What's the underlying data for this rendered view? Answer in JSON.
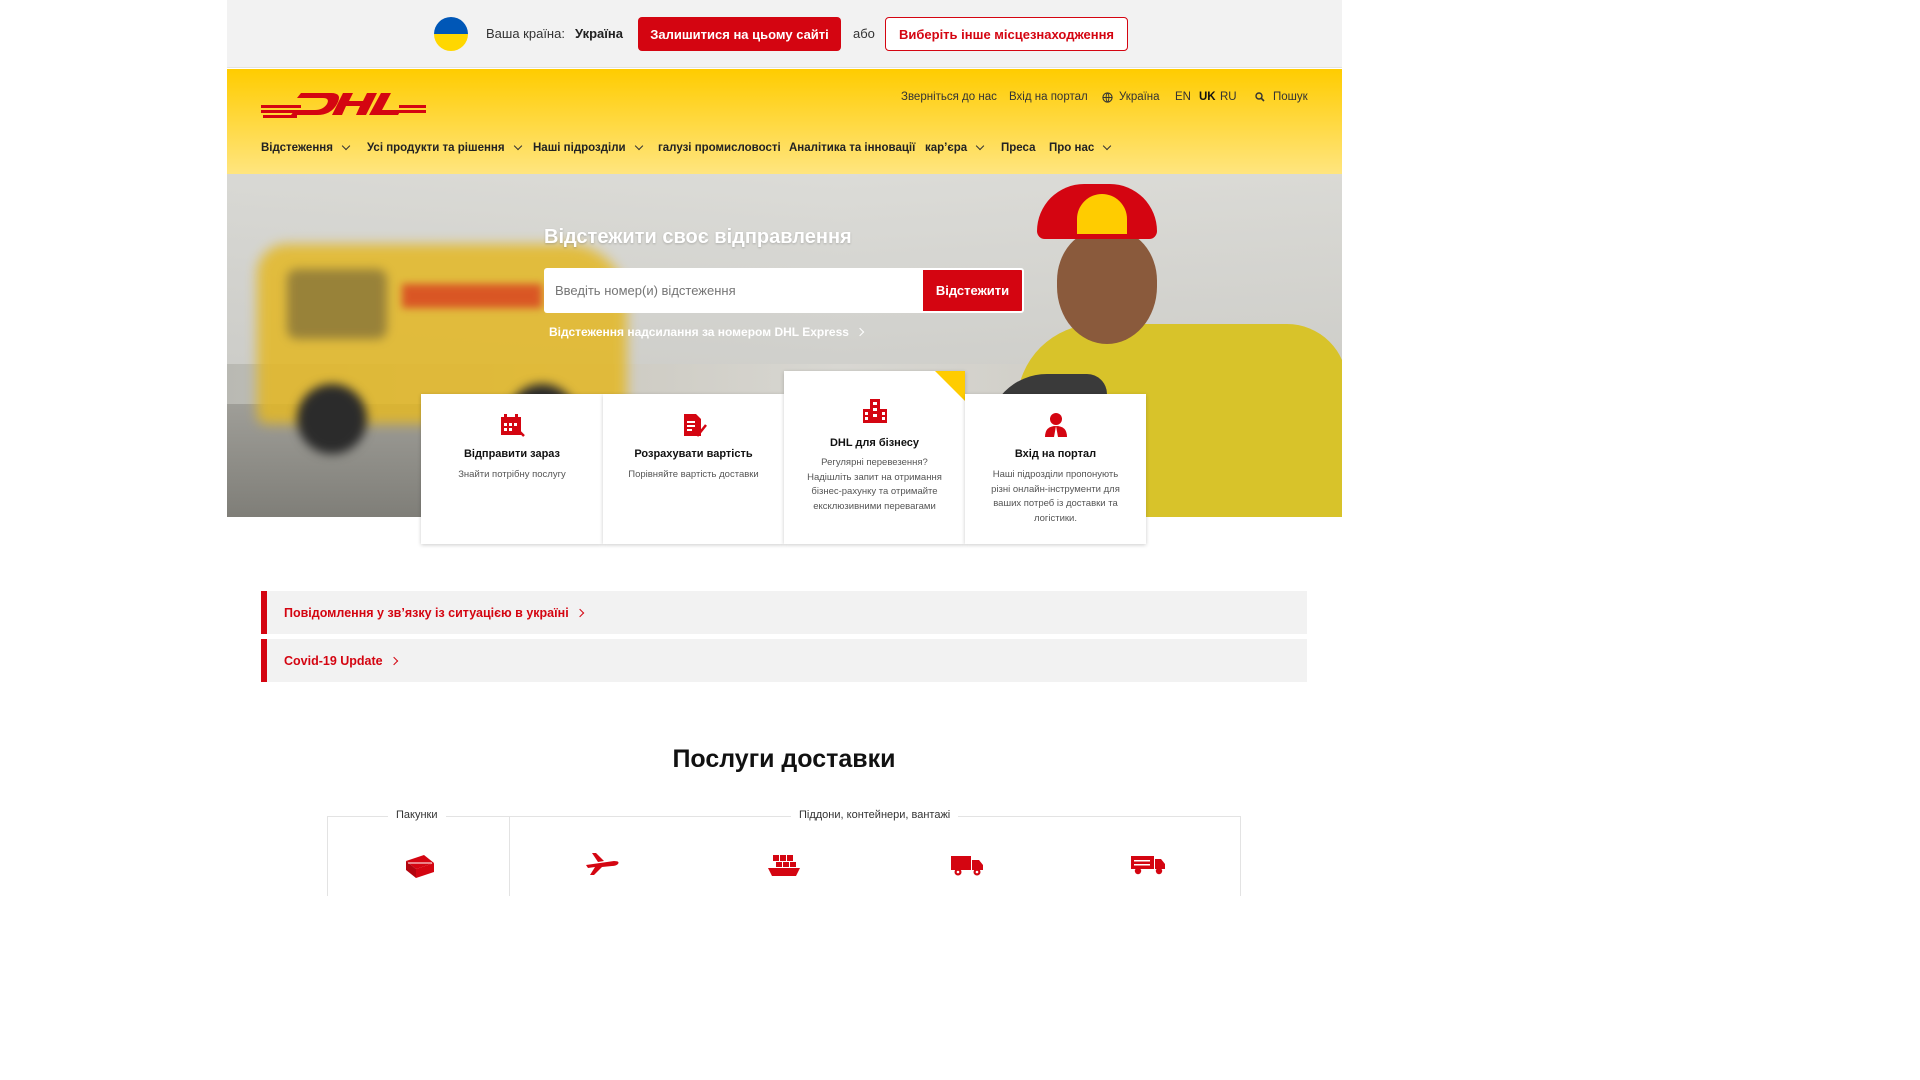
{
  "country_bar": {
    "label": "Ваша країна:",
    "country": "Україна",
    "stay_button": "Залишитися на цьому сайті",
    "or": "або",
    "other_button": "Виберіть інше місцезнаходження",
    "flag_colors": [
      "#0057b7",
      "#ffd700"
    ]
  },
  "header": {
    "logo": "DHL",
    "utility": {
      "contact": "Зверніться до нас",
      "portal": "Вхід на портал",
      "country": "Україна",
      "languages": [
        "EN",
        "UK",
        "RU"
      ],
      "active_language": "UK",
      "search": "Пошук"
    },
    "nav": [
      {
        "label": "Відстеження",
        "dropdown": true
      },
      {
        "label": "Усі продукти та рішення",
        "dropdown": true
      },
      {
        "label": "Наші підрозділи",
        "dropdown": true
      },
      {
        "label": "галузі промисловості",
        "dropdown": false
      },
      {
        "label": "Аналітика та інновації",
        "dropdown": false
      },
      {
        "label": "кар’єра",
        "dropdown": true
      },
      {
        "label": "Преса",
        "dropdown": false
      },
      {
        "label": "Про нас",
        "dropdown": true
      }
    ]
  },
  "hero": {
    "title": "Відстежити своє відправлення",
    "placeholder": "Введіть номер(и) відстеження",
    "track_button": "Відстежити",
    "express_link": "Відстеження надсилання за номером DHL Express"
  },
  "cards": [
    {
      "icon": "calendar-icon",
      "title": "Відправити зараз",
      "desc": "Знайти потрібну послугу"
    },
    {
      "icon": "document-check-icon",
      "title": "Розрахувати вартість",
      "desc": "Порівняйте вартість доставки"
    },
    {
      "icon": "building-icon",
      "title": "DHL для бізнесу",
      "desc": "Регулярні перевезення? Надішліть запит на отримання бізнес-рахунку та отримайте ексклюзивними перевагами"
    },
    {
      "icon": "user-icon",
      "title": "Вхід на портал",
      "desc": "Наші підрозділи пропонують різні онлайн-інструменти для ваших потреб із доставки та логістики."
    }
  ],
  "notices": [
    "Повідомлення у зв’язку із ситуацією в україні",
    "Covid-19 Update"
  ],
  "services": {
    "title": "Послуги доставки",
    "parcels_label": "Пакунки",
    "freight_label": "Піддони, контейнери, вантажі",
    "icons": [
      "parcels-icon",
      "air-freight-icon",
      "ocean-freight-icon",
      "road-freight-icon",
      "truck-icon"
    ]
  },
  "colors": {
    "brand_yellow": "#ffcc00",
    "brand_red": "#d40511"
  }
}
